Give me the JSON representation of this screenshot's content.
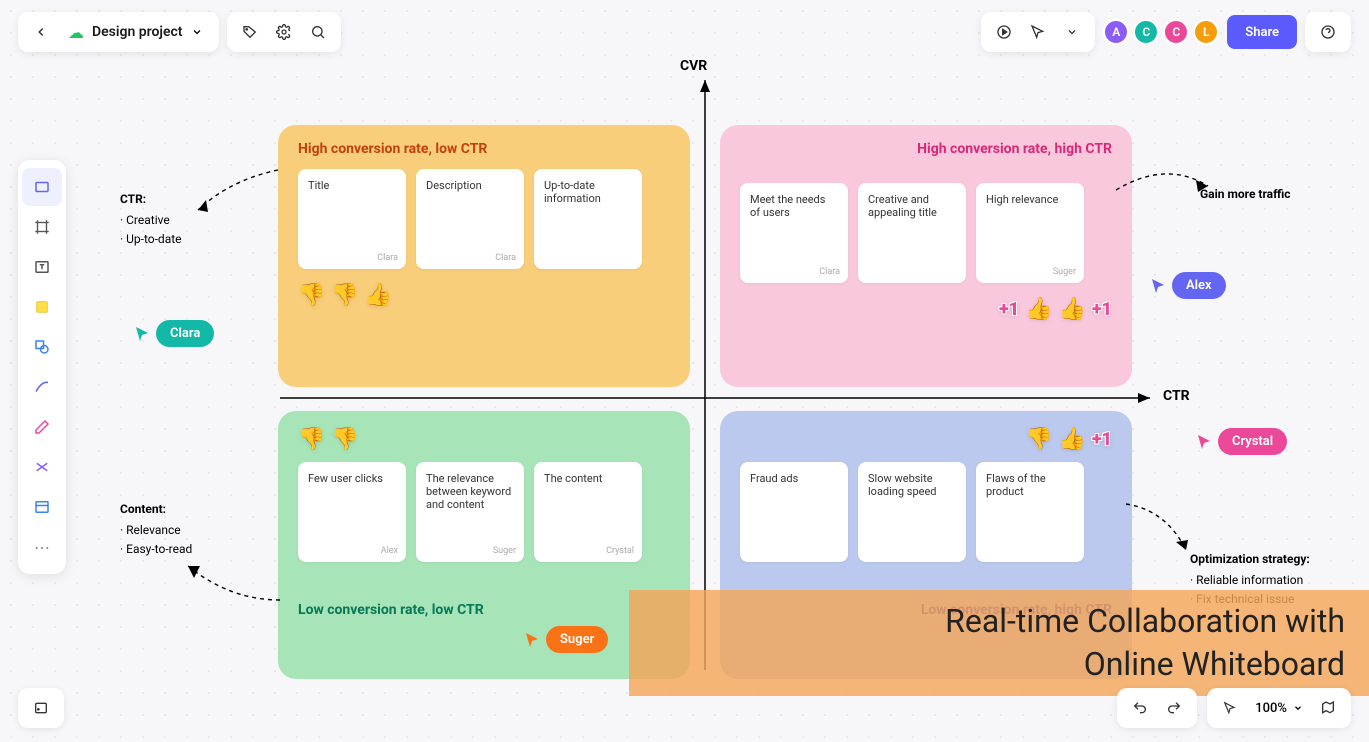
{
  "header": {
    "project_title": "Design project",
    "share_label": "Share",
    "users": [
      {
        "initial": "A",
        "color": "#8b5cf6"
      },
      {
        "initial": "C",
        "color": "#14b8a6"
      },
      {
        "initial": "C",
        "color": "#ec4899"
      },
      {
        "initial": "L",
        "color": "#f59e0b"
      }
    ],
    "zoom_level": "100%"
  },
  "axes": {
    "y": "CVR",
    "x": "CTR"
  },
  "quadrants": {
    "tl": {
      "title": "High conversion rate, low CTR",
      "bg": "#f8ce7a",
      "text": "#c2410c",
      "cards": [
        {
          "t": "Title",
          "a": "Clara"
        },
        {
          "t": "Description",
          "a": "Clara"
        },
        {
          "t": "Up-to-date information",
          "a": ""
        }
      ],
      "reactions": [
        "down",
        "down",
        "up"
      ]
    },
    "tr": {
      "title": "High conversion rate, high CTR",
      "bg": "#f9c8dd",
      "text": "#db2777",
      "cards": [
        {
          "t": "Meet the needs of users",
          "a": "Clara"
        },
        {
          "t": "Creative and appealing title",
          "a": ""
        },
        {
          "t": "High relevance",
          "a": "Suger"
        }
      ],
      "reactions": [
        "+1",
        "up",
        "up",
        "+1"
      ]
    },
    "bl": {
      "title": "Low conversion rate, low CTR",
      "bg": "#a7e4b8",
      "text": "#047857",
      "cards": [
        {
          "t": "Few user clicks",
          "a": "Alex"
        },
        {
          "t": "The relevance between keyword and content",
          "a": "Suger"
        },
        {
          "t": "The content",
          "a": "Crystal"
        }
      ],
      "reactions": [
        "down",
        "down"
      ],
      "reactions_top": true
    },
    "br": {
      "title": "Low conversion rate, high CTR",
      "bg": "#bcc9ee",
      "text": "#4338ca",
      "cards": [
        {
          "t": "Fraud ads",
          "a": ""
        },
        {
          "t": "Slow website loading speed",
          "a": ""
        },
        {
          "t": "Flaws of the product",
          "a": ""
        }
      ],
      "reactions": [
        "down",
        "up",
        "+1"
      ],
      "reactions_top": true
    }
  },
  "notes": {
    "ctr": {
      "hd": "CTR:",
      "items": [
        "Creative",
        "Up-to-date"
      ]
    },
    "content": {
      "hd": "Content:",
      "items": [
        "Relevance",
        "Easy-to-read"
      ]
    },
    "gain": "Gain more traffic",
    "opt": {
      "hd": "Optimization strategy:",
      "items": [
        "Reliable information",
        "Fix technical issue"
      ]
    }
  },
  "cursors": {
    "clara": {
      "name": "Clara",
      "color": "#14b8a6"
    },
    "alex": {
      "name": "Alex",
      "color": "#6366f1"
    },
    "suger": {
      "name": "Suger",
      "color": "#f97316"
    },
    "crystal": {
      "name": "Crystal",
      "color": "#ec4899"
    }
  },
  "overlay": {
    "line1": "Real-time Collaboration with",
    "line2": "Online Whiteboard"
  }
}
